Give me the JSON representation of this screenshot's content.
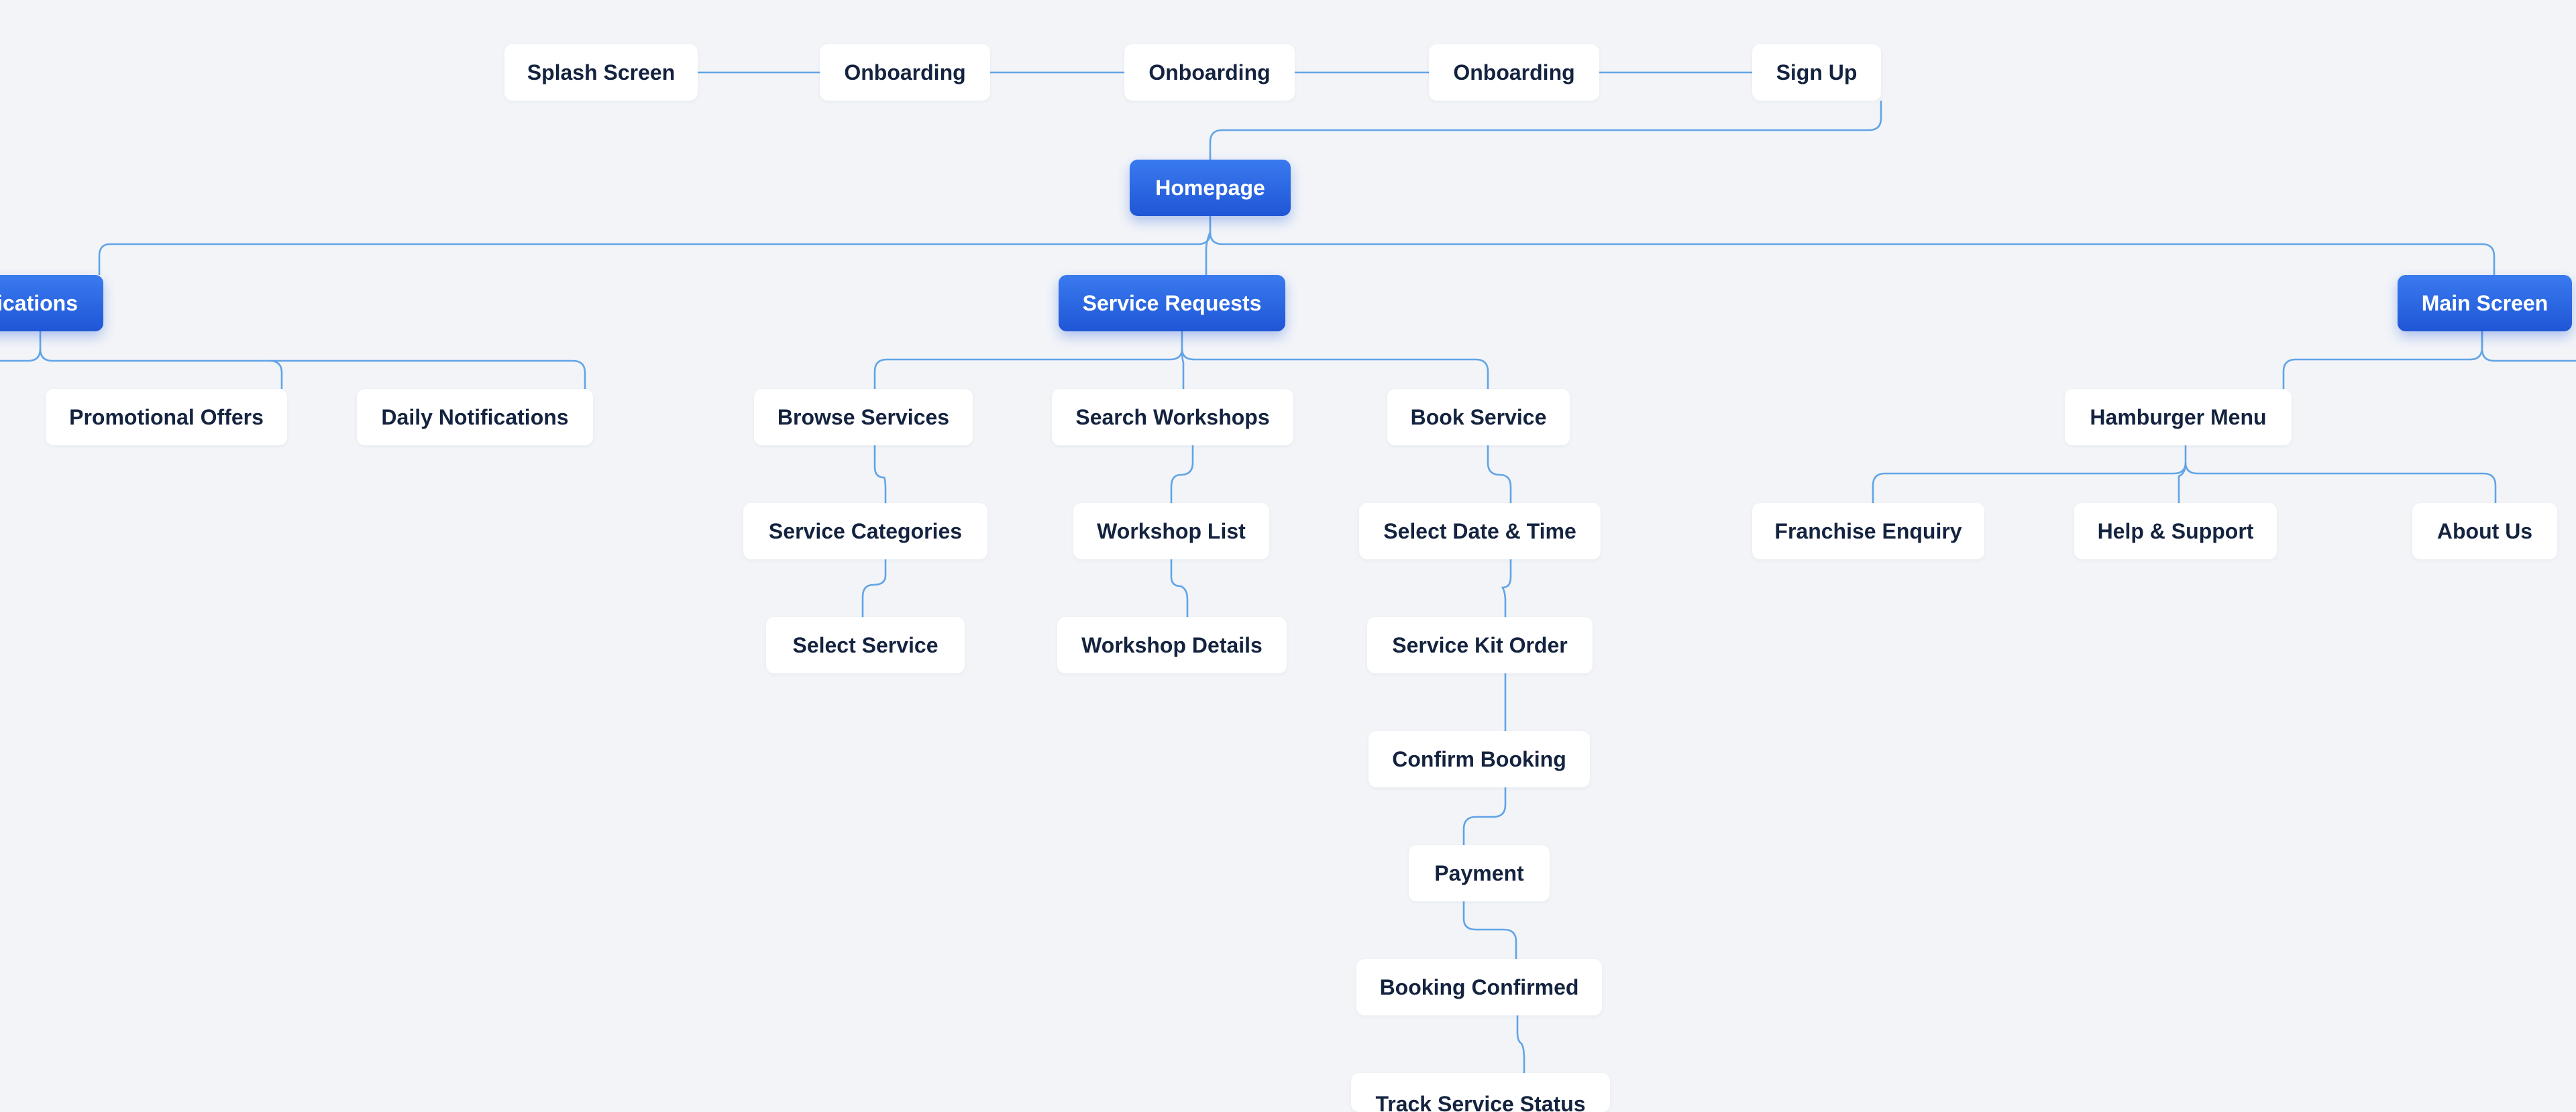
{
  "diagram": {
    "onboarding_row": {
      "splash_screen": "Splash Screen",
      "onboarding_1": "Onboarding",
      "onboarding_2": "Onboarding",
      "onboarding_3": "Onboarding",
      "sign_up": "Sign Up"
    },
    "homepage": "Homepage",
    "notifications_branch": {
      "title": "ications",
      "children": [
        "Promotional Offers",
        "Daily Notifications"
      ]
    },
    "service_requests_branch": {
      "title": "Service Requests",
      "browse_services": {
        "title": "Browse Services",
        "steps": [
          "Service Categories",
          "Select Service"
        ]
      },
      "search_workshops": {
        "title": "Search Workshops",
        "steps": [
          "Workshop List",
          "Workshop Details"
        ]
      },
      "book_service": {
        "title": "Book Service",
        "steps": [
          "Select Date & Time",
          "Service Kit Order",
          "Confirm Booking",
          "Payment",
          "Booking Confirmed",
          "Track Service Status"
        ]
      }
    },
    "main_screen_branch": {
      "title": "Main Screen",
      "hamburger_menu": {
        "title": "Hamburger Menu",
        "children": [
          "Franchise Enquiry",
          "Help & Support",
          "About Us"
        ]
      }
    }
  },
  "colors": {
    "background": "#f2f4f8",
    "node": "#ffffff",
    "node_text": "#14233f",
    "primary_node": "#2563eb",
    "primary_text": "#ffffff",
    "connector": "#62a4e6"
  }
}
